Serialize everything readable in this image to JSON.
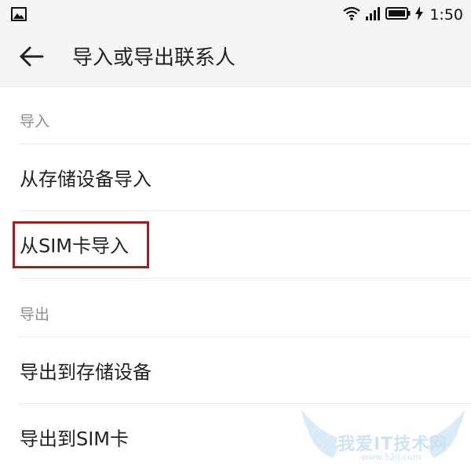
{
  "status_bar": {
    "time": "1:50",
    "icons": [
      "gallery-icon",
      "wifi-icon",
      "signal-icon",
      "battery-icon",
      "charging-icon"
    ]
  },
  "app_bar": {
    "title": "导入或导出联系人",
    "back_icon": "arrow-left-icon"
  },
  "sections": [
    {
      "header": "导入",
      "items": [
        {
          "label": "从存储设备导入"
        },
        {
          "label": "从SIM卡导入",
          "highlighted": true
        }
      ]
    },
    {
      "header": "导出",
      "items": [
        {
          "label": "导出到存储设备"
        },
        {
          "label": "导出到SIM卡"
        }
      ]
    }
  ],
  "watermark": {
    "text": "我爱IT技术网",
    "url": "www.52ij.com"
  },
  "colors": {
    "highlight_border": "#a51c1c",
    "header_text": "#8c8c8c",
    "bar_background": "#f5f5f5"
  }
}
